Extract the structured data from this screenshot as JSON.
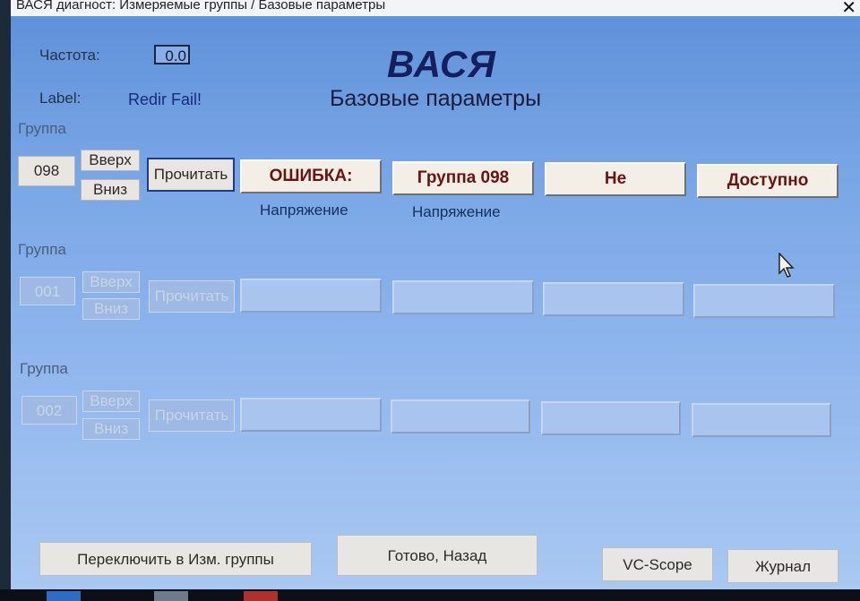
{
  "window": {
    "title": "ВАСЯ диагност: Измеряемые группы / Базовые параметры",
    "close": "✕"
  },
  "header": {
    "freq_label": "Частота:",
    "freq_value": "0.0",
    "label_label": "Label:",
    "label_value": "Redir Fail!",
    "brand": "ВАСЯ",
    "subtitle": "Базовые параметры"
  },
  "groups": [
    {
      "label": "Группа",
      "number": "098",
      "up": "Вверх",
      "down": "Вниз",
      "read": "Прочитать",
      "fields": [
        "ОШИБКА:",
        "Группа 098",
        "Не",
        "Доступно"
      ],
      "captions": [
        "Напряжение",
        "Напряжение",
        "",
        ""
      ],
      "enabled": true
    },
    {
      "label": "Группа",
      "number": "001",
      "up": "Вверх",
      "down": "Вниз",
      "read": "Прочитать",
      "fields": [
        "",
        "",
        "",
        ""
      ],
      "enabled": false
    },
    {
      "label": "Группа",
      "number": "002",
      "up": "Вверх",
      "down": "Вниз",
      "read": "Прочитать",
      "fields": [
        "",
        "",
        "",
        ""
      ],
      "enabled": false
    }
  ],
  "bottom": {
    "switch": "Переключить в Изм. группы",
    "done": "Готово, Назад",
    "vcscope": "VC-Scope",
    "journal": "Журнал"
  },
  "icons": {
    "close": "close-icon",
    "cursor": "mouse-pointer-icon"
  },
  "colors": {
    "field_text": "#6b1212",
    "brand": "#161f5e",
    "background": "#79a6e6"
  }
}
